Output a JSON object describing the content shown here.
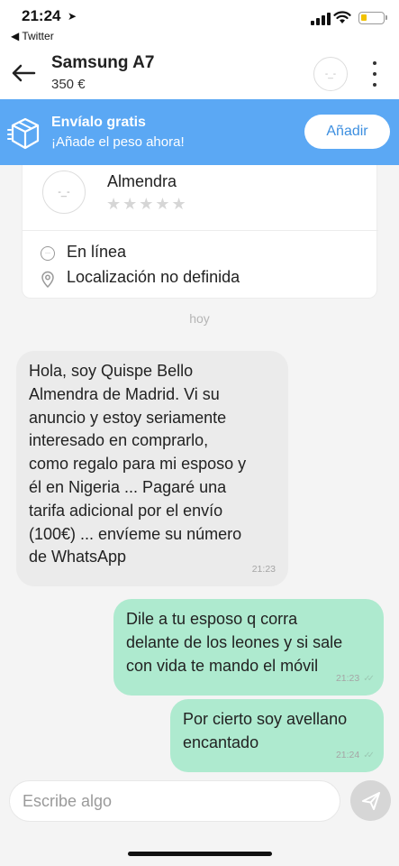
{
  "status_bar": {
    "time": "21:24",
    "location_glyph": "➤",
    "back_app": "◀ Twitter"
  },
  "header": {
    "title": "Samsung A7",
    "price": "350 €",
    "avatar_face": "-_-"
  },
  "shipping_banner": {
    "title": "Envíalo gratis",
    "subtitle": "¡Añade el peso ahora!",
    "button_label": "Añadir"
  },
  "profile": {
    "avatar_face": "-_-",
    "name": "Almendra",
    "stars": "★★★★★",
    "rating_filled": 0,
    "rating_max": 5,
    "online_glyph": "···",
    "status": "En línea",
    "location": "Localización no definida"
  },
  "date_separator": "hoy",
  "messages": [
    {
      "direction": "incoming",
      "text": "Hola, soy Quispe Bello\nAlmendra de Madrid. Vi su\nanuncio y estoy seriamente\ninteresado en comprarlo,\ncomo regalo para mi esposo y\nél en Nigeria ... Pagaré una\ntarifa adicional por el envío\n(100€) ... envíeme su número\nde WhatsApp",
      "time": "21:23"
    },
    {
      "direction": "outgoing",
      "text": "Dile a tu esposo q corra\ndelante de los leones y si sale\ncon vida te mando el móvil",
      "time": "21:23",
      "checks": "✓✓"
    },
    {
      "direction": "outgoing",
      "text": "Por cierto soy avellano\nencantado",
      "time": "21:24",
      "checks": "✓✓"
    }
  ],
  "composer": {
    "placeholder": "Escribe algo"
  },
  "colors": {
    "banner": "#5ba8f4",
    "outgoing_bubble": "#aeeacf",
    "incoming_bubble": "#ebebeb",
    "send_button": "#d6d6d6"
  },
  "icons": [
    "location-arrow-icon",
    "signal-icon",
    "wifi-icon",
    "battery-icon",
    "back-arrow-icon",
    "more-vertical-icon",
    "box-icon",
    "chat-bubble-icon",
    "map-pin-icon",
    "check-icon",
    "send-icon"
  ]
}
